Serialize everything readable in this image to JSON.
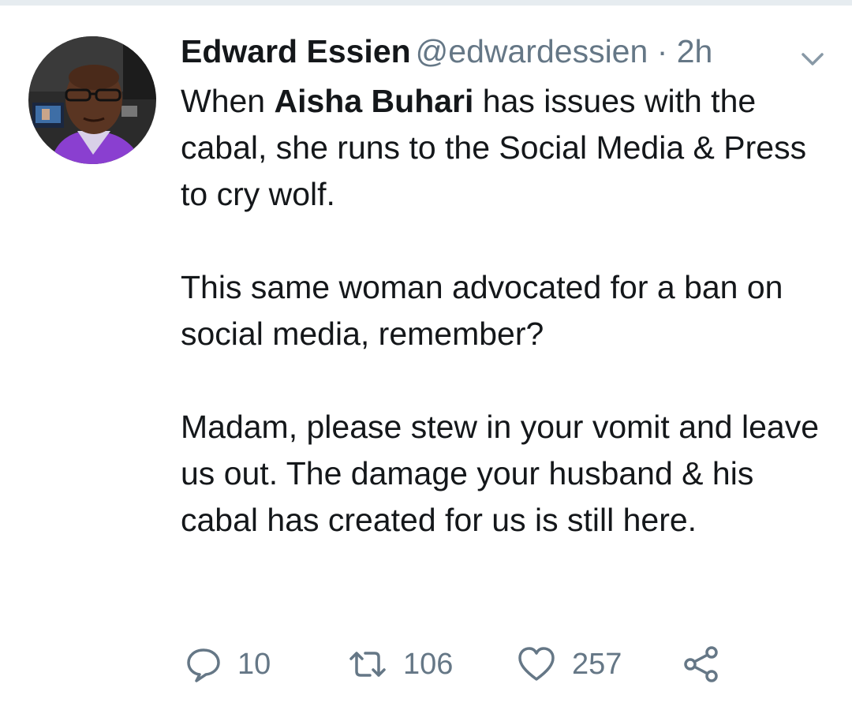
{
  "tweet": {
    "display_name": "Edward Essien",
    "handle": "@edwardessien",
    "separator": "·",
    "timestamp": "2h",
    "paragraphs": [
      {
        "pre": "When ",
        "bold": "Aisha Buhari",
        "post": " has issues with the cabal, she runs to the Social Media & Press to cry wolf."
      },
      {
        "text": "This same woman advocated for a ban on social media, remember?"
      },
      {
        "text": "Madam, please stew in your vomit and leave us out. The damage your husband & his cabal has created for us is still here."
      }
    ],
    "actions": {
      "replies": "10",
      "retweets": "106",
      "likes": "257"
    }
  },
  "icons": {
    "menu": "chevron-down-icon",
    "reply": "reply-icon",
    "retweet": "retweet-icon",
    "like": "heart-icon",
    "share": "share-icon"
  },
  "colors": {
    "text_primary": "#14171a",
    "text_secondary": "#657786",
    "divider": "#e6ecf0",
    "avatar_shirt": "#8a3fd0"
  }
}
